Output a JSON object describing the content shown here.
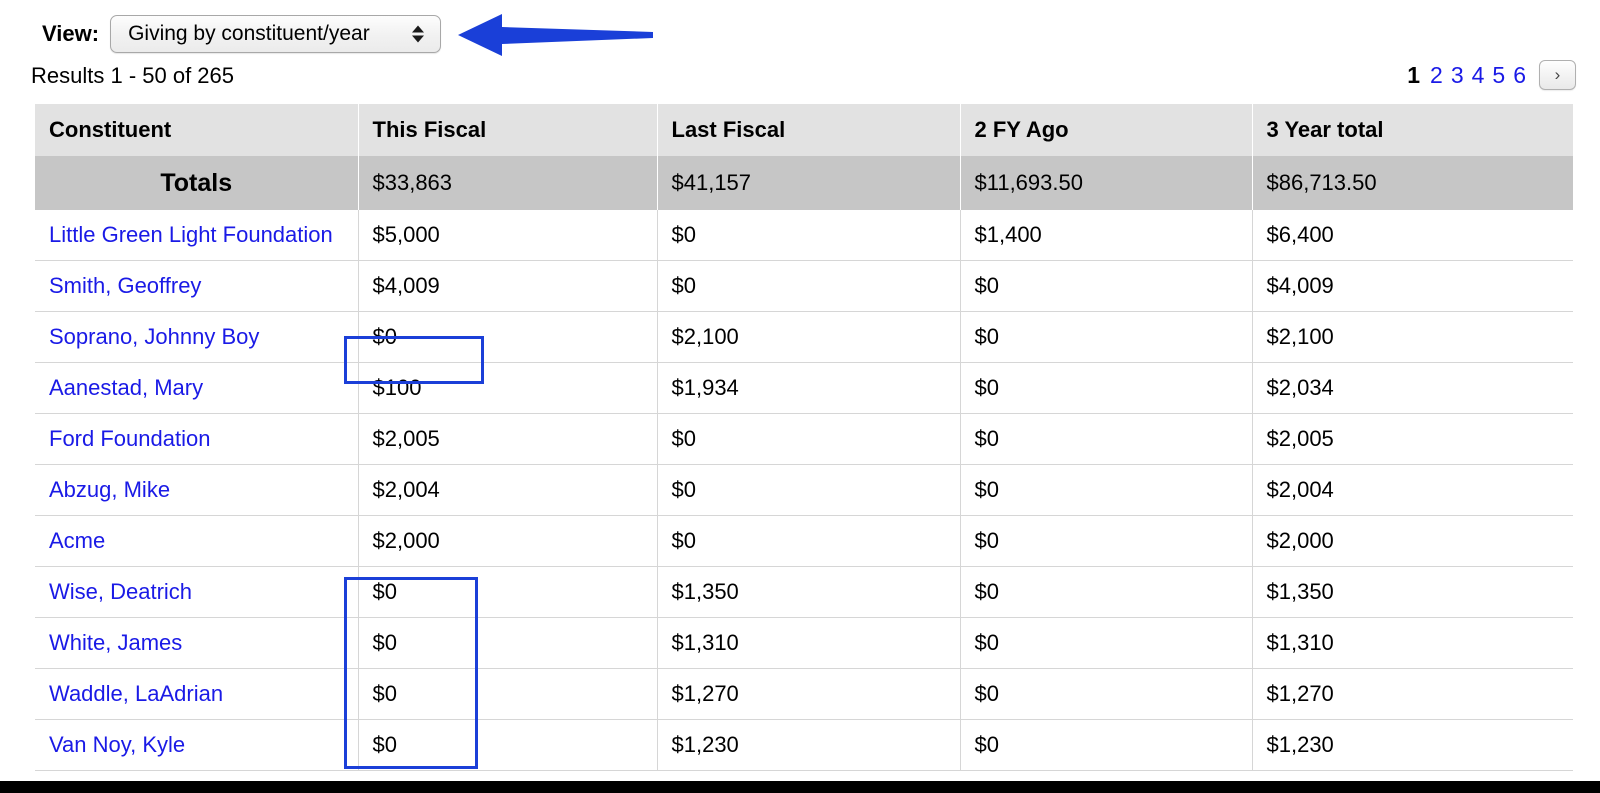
{
  "toolbar": {
    "view_label": "View:",
    "view_selected": "Giving by constituent/year",
    "stepper_icon": "up-down-stepper-icon"
  },
  "annotation": {
    "arrow_icon": "left-pointing-arrow-icon",
    "arrow_color": "#1a3fd8"
  },
  "results": {
    "summary": "Results 1 - 50 of 265"
  },
  "pagination": {
    "pages": [
      "1",
      "2",
      "3",
      "4",
      "5",
      "6"
    ],
    "current_page": "1",
    "next_label": "›",
    "link_color": "#1a1ae6"
  },
  "table": {
    "columns": [
      "Constituent",
      "This Fiscal",
      "Last Fiscal",
      "2 FY Ago",
      "3 Year total"
    ],
    "totals": {
      "label": "Totals",
      "this_fiscal": "$33,863",
      "last_fiscal": "$41,157",
      "two_fy_ago": "$11,693.50",
      "three_year_total": "$86,713.50"
    },
    "rows": [
      {
        "name": "Little Green Light Foundation",
        "this_fiscal": "$5,000",
        "last_fiscal": "$0",
        "two_fy_ago": "$1,400",
        "three_year_total": "$6,400"
      },
      {
        "name": "Smith, Geoffrey",
        "this_fiscal": "$4,009",
        "last_fiscal": "$0",
        "two_fy_ago": "$0",
        "three_year_total": "$4,009"
      },
      {
        "name": "Soprano, Johnny Boy",
        "this_fiscal": "$0",
        "last_fiscal": "$2,100",
        "two_fy_ago": "$0",
        "three_year_total": "$2,100"
      },
      {
        "name": "Aanestad, Mary",
        "this_fiscal": "$100",
        "last_fiscal": "$1,934",
        "two_fy_ago": "$0",
        "three_year_total": "$2,034"
      },
      {
        "name": "Ford Foundation",
        "this_fiscal": "$2,005",
        "last_fiscal": "$0",
        "two_fy_ago": "$0",
        "three_year_total": "$2,005"
      },
      {
        "name": "Abzug, Mike",
        "this_fiscal": "$2,004",
        "last_fiscal": "$0",
        "two_fy_ago": "$0",
        "three_year_total": "$2,004"
      },
      {
        "name": "Acme",
        "this_fiscal": "$2,000",
        "last_fiscal": "$0",
        "two_fy_ago": "$0",
        "three_year_total": "$2,000"
      },
      {
        "name": "Wise, Deatrich",
        "this_fiscal": "$0",
        "last_fiscal": "$1,350",
        "two_fy_ago": "$0",
        "three_year_total": "$1,350"
      },
      {
        "name": "White, James",
        "this_fiscal": "$0",
        "last_fiscal": "$1,310",
        "two_fy_ago": "$0",
        "three_year_total": "$1,310"
      },
      {
        "name": "Waddle, LaAdrian",
        "this_fiscal": "$0",
        "last_fiscal": "$1,270",
        "two_fy_ago": "$0",
        "three_year_total": "$1,270"
      },
      {
        "name": "Van Noy, Kyle",
        "this_fiscal": "$0",
        "last_fiscal": "$1,230",
        "two_fy_ago": "$0",
        "three_year_total": "$1,230"
      }
    ],
    "highlight_color": "#1b3fd8"
  }
}
